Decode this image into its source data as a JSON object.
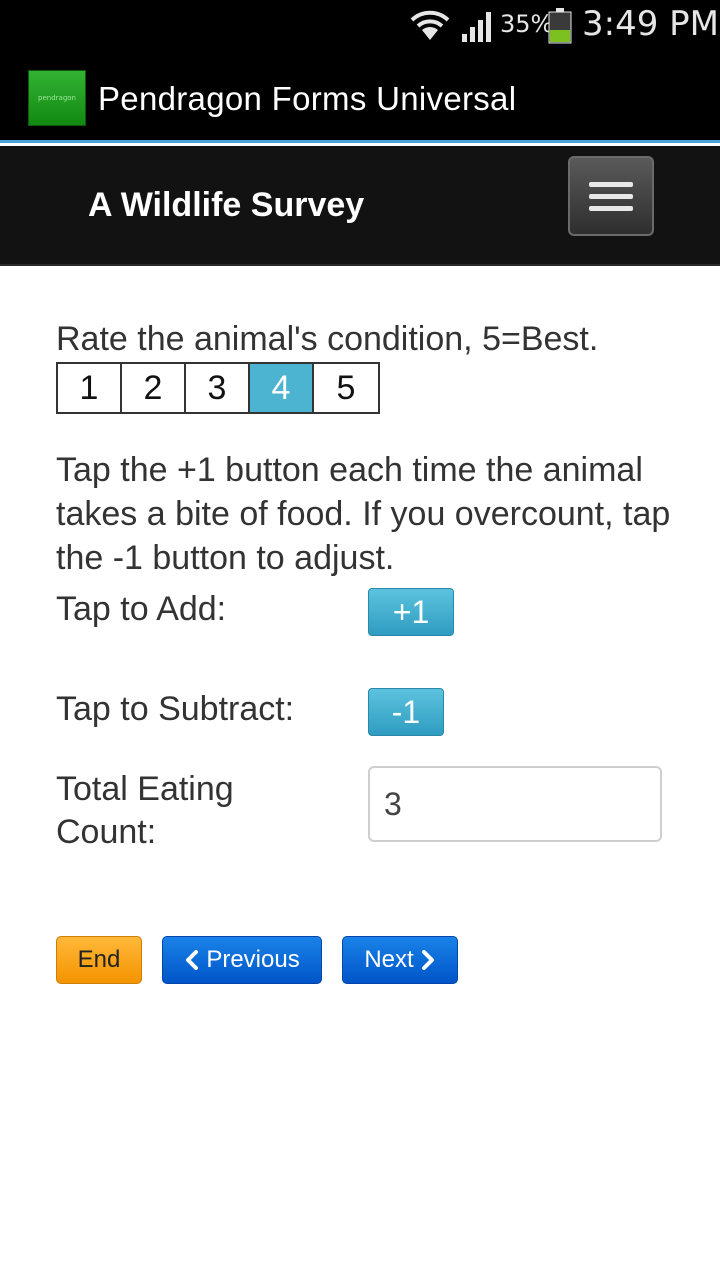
{
  "status_bar": {
    "battery_percent": "35%",
    "time": "3:49 PM",
    "icons": [
      "wifi-icon",
      "signal-icon",
      "battery-icon"
    ]
  },
  "app": {
    "title": "Pendragon Forms Universal",
    "logo_icon": "pendragon-logo",
    "logo_text": "pendragon"
  },
  "form": {
    "title": "A Wildlife Survey",
    "menu_icon": "hamburger-menu-icon"
  },
  "rating_question": {
    "label": "Rate the animal's condition, 5=Best.",
    "options": [
      "1",
      "2",
      "3",
      "4",
      "5"
    ],
    "selected": "4"
  },
  "instructions": "Tap the +1 button each time the animal takes a bite of food. If you overcount, tap the -1 button to adjust.",
  "add_row": {
    "label": "Tap to Add:",
    "button": "+1"
  },
  "subtract_row": {
    "label": "Tap to Subtract:",
    "button": "-1"
  },
  "total_row": {
    "label": "Total Eating Count:",
    "value": "3"
  },
  "navigation": {
    "end": "End",
    "previous": "Previous",
    "next": "Next"
  },
  "colors": {
    "accent_blue": "#4cb3d0",
    "nav_blue": "#0a6fdc",
    "end_orange": "#f7a21b",
    "actionbar_line": "#4aa3d6"
  }
}
